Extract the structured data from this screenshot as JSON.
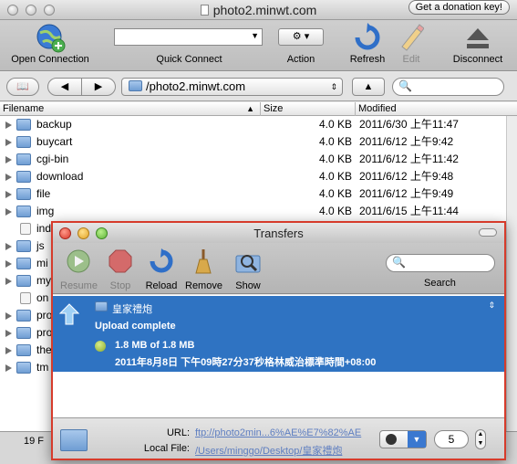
{
  "main": {
    "title": "photo2.minwt.com",
    "donate_label": "Get a donation key!",
    "toolbar": {
      "open_connection": "Open Connection",
      "quick_connect": "Quick Connect",
      "action": "Action",
      "refresh": "Refresh",
      "edit": "Edit",
      "disconnect": "Disconnect"
    },
    "path": "/photo2.minwt.com",
    "columns": {
      "filename": "Filename",
      "size": "Size",
      "modified": "Modified"
    },
    "files": [
      {
        "name": "backup",
        "size": "4.0 KB",
        "modified": "2011/6/30 上午11:47"
      },
      {
        "name": "buycart",
        "size": "4.0 KB",
        "modified": "2011/6/12 上午9:42"
      },
      {
        "name": "cgi-bin",
        "size": "4.0 KB",
        "modified": "2011/6/12 上午11:42"
      },
      {
        "name": "download",
        "size": "4.0 KB",
        "modified": "2011/6/12 上午9:48"
      },
      {
        "name": "file",
        "size": "4.0 KB",
        "modified": "2011/6/12 上午9:49"
      },
      {
        "name": "img",
        "size": "4.0 KB",
        "modified": "2011/6/15 上午11:44"
      }
    ],
    "partial_names": [
      "ind",
      "js",
      "mi",
      "my",
      "on",
      "pro",
      "pro",
      "the",
      "tm"
    ],
    "status": "19 F"
  },
  "transfers": {
    "title": "Transfers",
    "toolbar": {
      "resume": "Resume",
      "stop": "Stop",
      "reload": "Reload",
      "remove": "Remove",
      "show": "Show",
      "search": "Search"
    },
    "item": {
      "name": "皇家禮炮",
      "status": "Upload complete",
      "progress": "1.8 MB of 1.8 MB",
      "date": "2011年8月8日 下午09時27分37秒格林威治標準時間+08:00"
    },
    "url_label": "URL:",
    "url": "ftp://photo2min...6%AE%E7%82%AE",
    "local_label": "Local File:",
    "local": "/Users/minggo/Desktop/皇家禮炮",
    "connections": "5"
  }
}
